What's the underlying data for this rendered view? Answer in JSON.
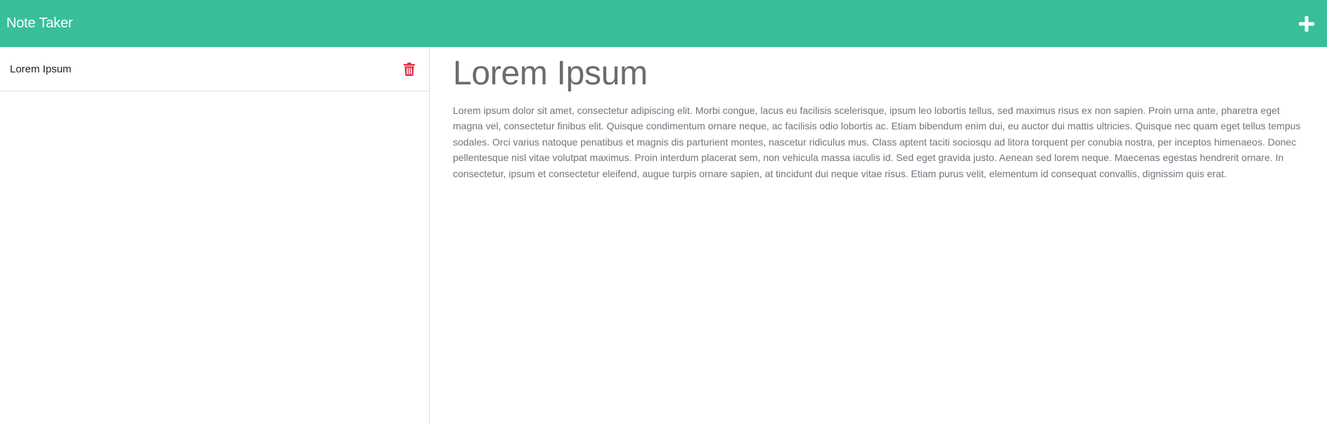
{
  "header": {
    "brand": "Note Taker",
    "add_icon": "plus-icon",
    "background": "#38bf9a"
  },
  "sidebar": {
    "items": [
      {
        "title": "Lorem Ipsum",
        "delete_icon": "trash-icon",
        "delete_color": "#dc3545"
      }
    ]
  },
  "note": {
    "title": "Lorem Ipsum",
    "body": "Lorem ipsum dolor sit amet, consectetur adipiscing elit. Morbi congue, lacus eu facilisis scelerisque, ipsum leo lobortis tellus, sed maximus risus ex non sapien. Proin urna ante, pharetra eget magna vel, consectetur finibus elit. Quisque condimentum ornare neque, ac facilisis odio lobortis ac. Etiam bibendum enim dui, eu auctor dui mattis ultricies. Quisque nec quam eget tellus tempus sodales. Orci varius natoque penatibus et magnis dis parturient montes, nascetur ridiculus mus. Class aptent taciti sociosqu ad litora torquent per conubia nostra, per inceptos himenaeos. Donec pellentesque nisl vitae volutpat maximus. Proin interdum placerat sem, non vehicula massa iaculis id. Sed eget gravida justo. Aenean sed lorem neque. Maecenas egestas hendrerit ornare. In consectetur, ipsum et consectetur eleifend, augue turpis ornare sapien, at tincidunt dui neque vitae risus. Etiam purus velit, elementum id consequat convallis, dignissim quis erat."
  }
}
